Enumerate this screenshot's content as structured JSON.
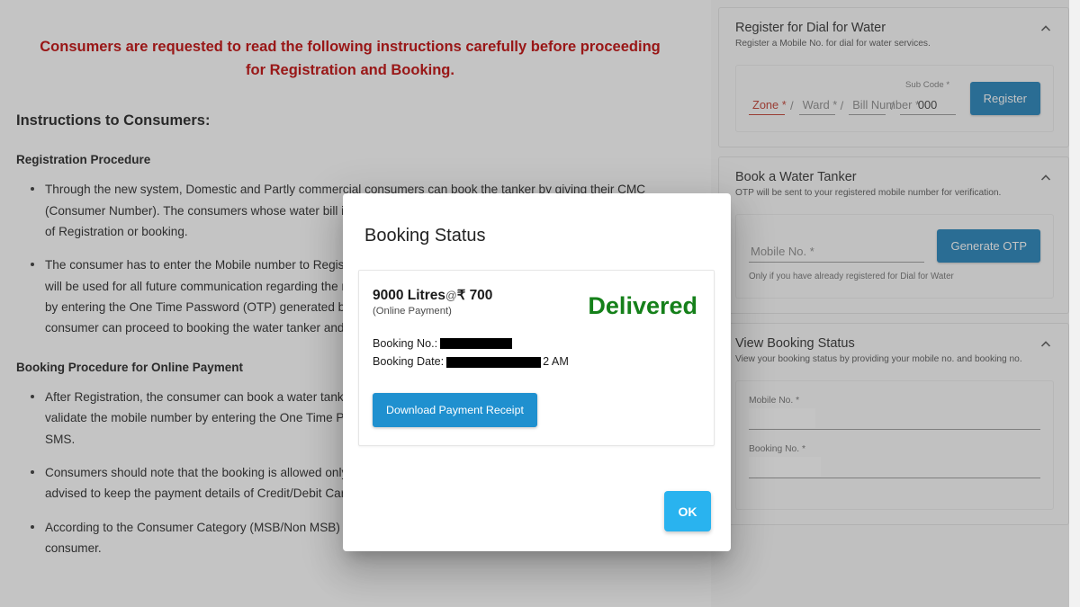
{
  "content": {
    "notice": "Consumers are requested to read the following instructions carefully before proceeding for Registration and Booking.",
    "heading": "Instructions to Consumers:",
    "section1_title": "Registration Procedure",
    "section1_bullets": [
      "Through the new system, Domestic and Partly commercial consumers can book the tanker by giving their CMC (Consumer Number). The consumers whose water bill is pending are not allowed to book the water tanker on the date of Registration or booking.",
      "The consumer has to enter the Mobile number to Register for availing the dial for water services. The Mobile number will be used for all future communication regarding the registration. The consumer has to validate the mobile number by entering the One Time Password (OTP) generated by the system and sent through SMS. Once validated the consumer can proceed to booking the water tanker and make the online payment."
    ],
    "section2_title": "Booking Procedure for Online Payment",
    "section2_bullets": [
      "After Registration, the consumer can book a water tanker using the registered Mobile number. The consumer has to validate the mobile number by entering the One Time Password (OTP) generated by the system and sent through SMS.",
      "Consumers should note that the booking is allowed only through online payment mode. Hence the consumers are advised to keep the payment details of Credit/Debit Card and Net Banking, ready before proceeding.",
      "According to the Consumer Category (MSB/Non MSB) the different options of booking will be made available to the consumer."
    ]
  },
  "sidebar": {
    "panels": [
      {
        "title": "Register for Dial for Water",
        "subtitle": "Register a Mobile No. for dial for water services.",
        "zone_label": "Zone *",
        "ward_label": "Ward *",
        "bill_label": "Bill Number *",
        "subcode_label": "Sub Code *",
        "subcode_value": "000",
        "separator": "/",
        "button": "Register"
      },
      {
        "title": "Book a Water Tanker",
        "subtitle": "OTP will be sent to your registered mobile number for verification.",
        "mobile_label": "Mobile No. *",
        "hint": "Only if you have already registered for Dial for Water",
        "button": "Generate OTP"
      },
      {
        "title": "View Booking Status",
        "subtitle": "View your booking status by providing your mobile no. and booking no.",
        "mobile_label": "Mobile No. *",
        "booking_label": "Booking No. *"
      }
    ],
    "collapse_icon": "chevron-up-icon"
  },
  "dialog": {
    "title": "Booking Status",
    "quantity": "9000 Litres",
    "at_symbol": "@",
    "rupee_symbol": "₹",
    "amount": "700",
    "payment_mode": "(Online Payment)",
    "booking_no_label": "Booking No.:",
    "booking_no_value": "",
    "booking_date_label": "Booking Date:",
    "booking_date_value": "2 AM",
    "status": "Delivered",
    "status_color": "#15801a",
    "download_button": "Download Payment Receipt",
    "ok_button": "OK"
  },
  "colors": {
    "notice": "#c00000",
    "primary_blue": "#1d7fb8",
    "download_blue": "#1f90cf",
    "ok_blue": "#29b3ef",
    "delivered_green": "#15801a"
  }
}
